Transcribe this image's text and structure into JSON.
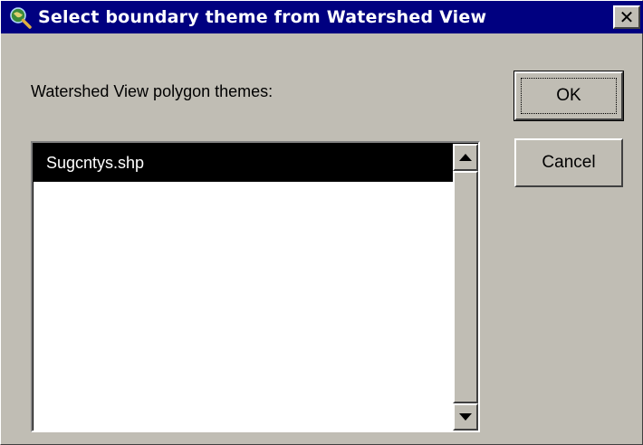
{
  "window": {
    "title": "Select boundary theme from Watershed View",
    "close_glyph": "✕",
    "icon": "globe-magnifier-icon"
  },
  "dialog": {
    "prompt_label": "Watershed View polygon themes:",
    "list_items": [
      {
        "label": "Sugcntys.shp",
        "selected": true
      }
    ],
    "buttons": {
      "ok_label": "OK",
      "cancel_label": "Cancel"
    }
  },
  "colors": {
    "titlebar": "#000080",
    "face": "#c0bdb4",
    "selection": "#000000"
  }
}
